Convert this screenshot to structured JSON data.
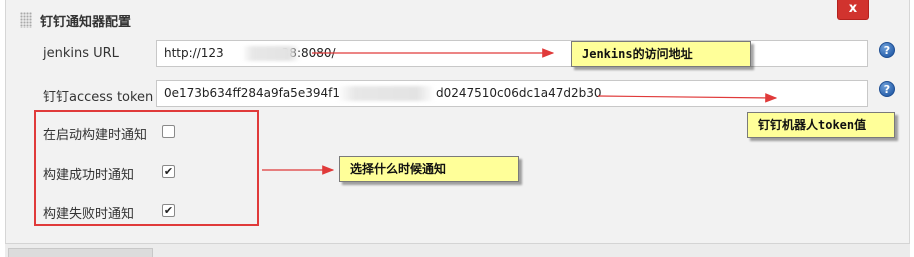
{
  "section": {
    "title": "钉钉通知器配置",
    "close_label": "x"
  },
  "fields": {
    "jenkins_url": {
      "label": "jenkins URL",
      "value_prefix": "http://123",
      "value_suffix": "38:8080/"
    },
    "access_token": {
      "label": "钉钉access token",
      "value_prefix": "0e173b634ff284a9fa5e394f1",
      "value_suffix": "d0247510c06dc1a47d2b30"
    }
  },
  "help_icon": "?",
  "checkboxes": [
    {
      "label": "在启动构建时通知",
      "checked": false,
      "glyph": ""
    },
    {
      "label": "构建成功时通知",
      "checked": true,
      "glyph": "✔"
    },
    {
      "label": "构建失败时通知",
      "checked": true,
      "glyph": "✔"
    }
  ],
  "annotations": {
    "jenkins_url_note": "Jenkins的访问地址",
    "token_note": "钉钉机器人token值",
    "notify_note": "选择什么时候通知"
  },
  "colors": {
    "close_button": "#d1332e",
    "annotation_red": "#e03a3a",
    "callout_bg": "#ffff99",
    "help_icon": "#2f66b0"
  }
}
